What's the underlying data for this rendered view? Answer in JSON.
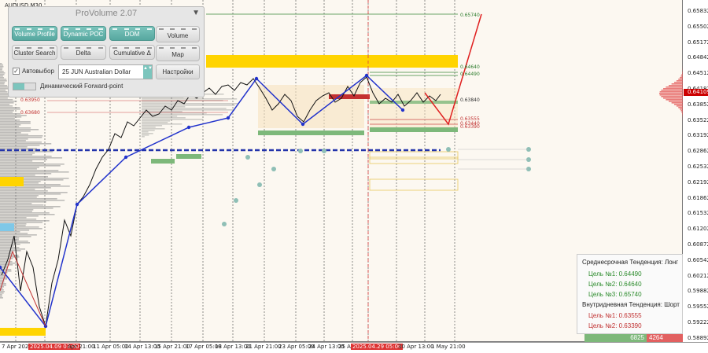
{
  "symbol": "AUDUSD,M30",
  "panel": {
    "title": "ProVolume 2.07",
    "close_glyph": "▼",
    "buttons": [
      {
        "label": "Volume Profile",
        "active": true
      },
      {
        "label": "Dynamic POC",
        "active": true
      },
      {
        "label": "DOM",
        "active": true
      },
      {
        "label": "Volume",
        "active": false
      },
      {
        "label": "Cluster Search",
        "active": false
      },
      {
        "label": "Delta",
        "active": false
      },
      {
        "label": "Cumulative Δ",
        "active": false
      },
      {
        "label": "Map",
        "active": false
      }
    ],
    "auto_select_label": "Автовыбор",
    "auto_select_checked": "✓",
    "instrument_value": "25 JUN Australian Dollar",
    "instrument_arrows": "▲▼",
    "settings_label": "Настройки",
    "forward_point_label": "Динамический Forward-point"
  },
  "price_axis": {
    "labels": [
      "0.65832",
      "0.65502",
      "0.65172",
      "0.64842",
      "0.64512",
      "0.64182",
      "0.63852",
      "0.63522",
      "0.63192",
      "0.62862",
      "0.62532",
      "0.62192",
      "0.61862",
      "0.61532",
      "0.61202",
      "0.60872",
      "0.60542",
      "0.60212",
      "0.59882",
      "0.59552",
      "0.59222",
      "0.58892"
    ],
    "current_price": "0.64109"
  },
  "level_labels": {
    "l1": "0.65740",
    "l2": "0.64640",
    "l3": "0.64490",
    "l4": "0.63840",
    "l5": "0.63555",
    "l6": "0.63440",
    "l7": "0.63390",
    "l8": "0.63950",
    "l9": "0.63680"
  },
  "time_axis": {
    "labels": [
      {
        "text": "7 Apr 2025",
        "hl": false
      },
      {
        "text": "2025.04.09 03:00",
        "hl": true
      },
      {
        "text": "Apr 21:00",
        "hl": false
      },
      {
        "text": "11 Apr 05:00",
        "hl": false
      },
      {
        "text": "14 Apr 13:00",
        "hl": false
      },
      {
        "text": "15 Apr 21:00",
        "hl": false
      },
      {
        "text": "17 Apr 05:00",
        "hl": false
      },
      {
        "text": "18 Apr 13:00",
        "hl": false
      },
      {
        "text": "21 Apr 21:00",
        "hl": false
      },
      {
        "text": "23 Apr 05:00",
        "hl": false
      },
      {
        "text": "24 Apr 13:00",
        "hl": false
      },
      {
        "text": "25 Apr",
        "hl": false
      },
      {
        "text": "2025.04.29 05:00",
        "hl": true
      },
      {
        "text": "30 Apr 13:00",
        "hl": false
      },
      {
        "text": "1 May 21:00",
        "hl": false
      }
    ]
  },
  "trend_panel": {
    "medium_title": "Среднесрочная Тенденция: Лонг",
    "medium_targets": [
      "Цель №1: 0.64490",
      "Цель №2: 0.64640",
      "Цель №3: 0.65740"
    ],
    "intraday_title": "Внутридневная Тенденция: Шорт",
    "intraday_targets": [
      "Цель №1: 0.63555",
      "Цель №2: 0.63390"
    ]
  },
  "volume_bar": {
    "buy": "6825",
    "sell": "4264"
  },
  "colors": {
    "zigzag": "#2233cc",
    "projection": "#e02020",
    "zone_yellow": "#ffd400",
    "zone_green": "#7db87a",
    "profile": "#8a8a8a",
    "poc_line": "#2233aa"
  }
}
